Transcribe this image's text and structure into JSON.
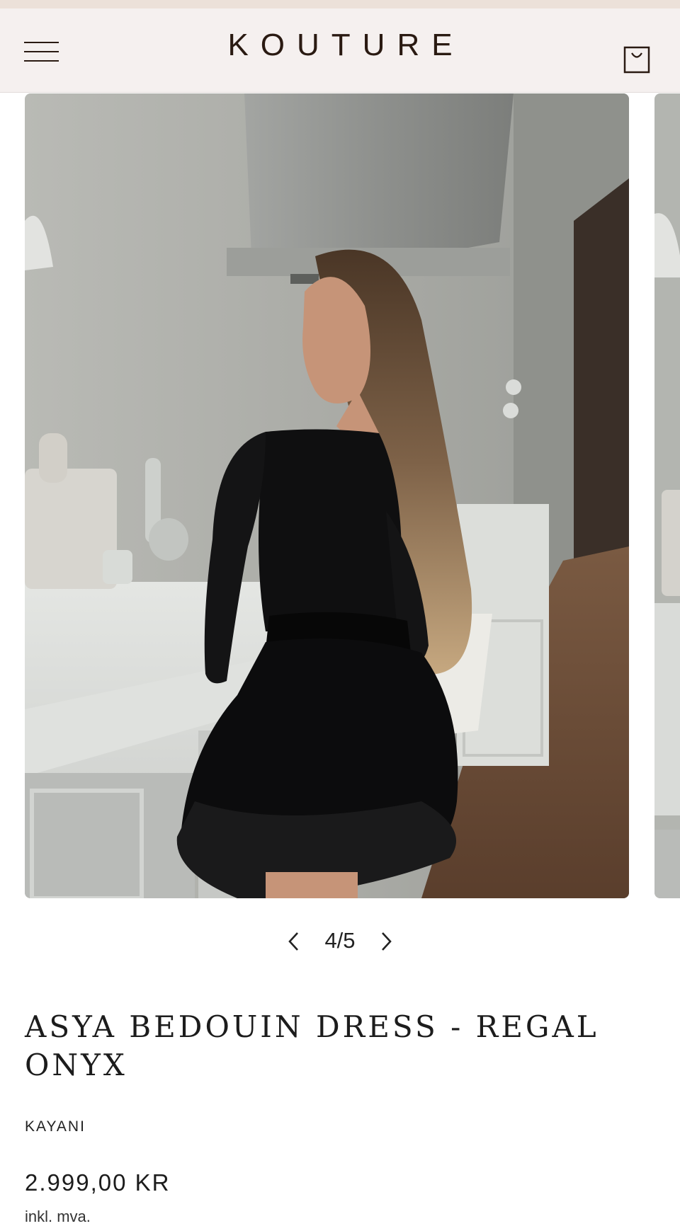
{
  "header": {
    "logo": "KOUTURE",
    "menu_icon": "hamburger-menu-icon",
    "cart_icon": "shopping-bag-icon"
  },
  "gallery": {
    "counter": "4/5",
    "prev_icon": "chevron-left-icon",
    "next_icon": "chevron-right-icon"
  },
  "product": {
    "title": "ASYA BEDOUIN DRESS - REGAL ONYX",
    "vendor": "KAYANI",
    "price": "2.999,00 KR",
    "tax_note": "inkl. mva."
  },
  "colors": {
    "header_bg": "#f5f0ef",
    "announce_bg": "#ece1d9",
    "logo": "#2a1a12"
  }
}
